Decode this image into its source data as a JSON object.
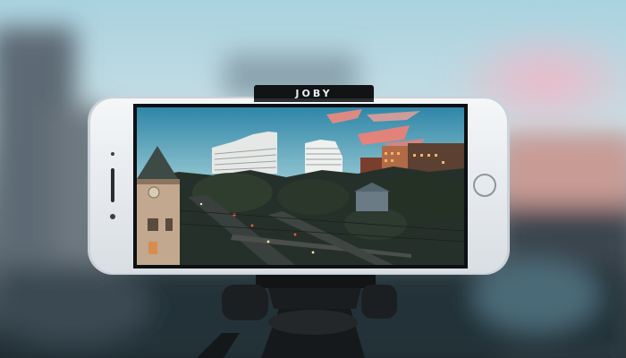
{
  "photo": {
    "mount_brand_label": "JOBY"
  },
  "colors": {
    "sky_top": "#bfe0ea",
    "sky_bottom": "#f3c9c4",
    "phone_body": "#eaeef2",
    "mount_black": "#141618",
    "cloud_pink": "#f08a7e"
  }
}
